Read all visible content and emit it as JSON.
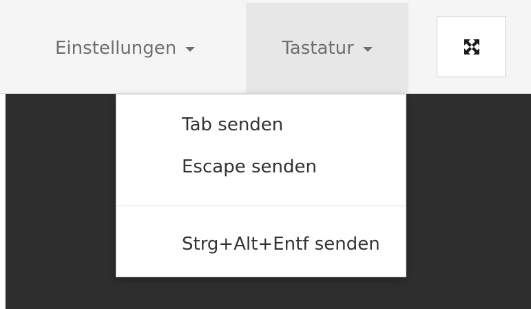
{
  "navbar": {
    "settings_label": "Einstellungen",
    "keyboard_label": "Tastatur",
    "fullscreen_icon": "fullscreen-expand-icon"
  },
  "keyboard_menu": {
    "items": [
      {
        "label": "Tab senden"
      },
      {
        "label": "Escape senden"
      },
      {
        "label": "Strg+Alt+Entf senden"
      }
    ]
  },
  "colors": {
    "navbar_bg": "#f5f5f5",
    "active_tab_bg": "#e7e7e7",
    "nav_text": "#6e6e6e",
    "menu_text": "#333333",
    "content_bg": "#2e2e2e"
  }
}
